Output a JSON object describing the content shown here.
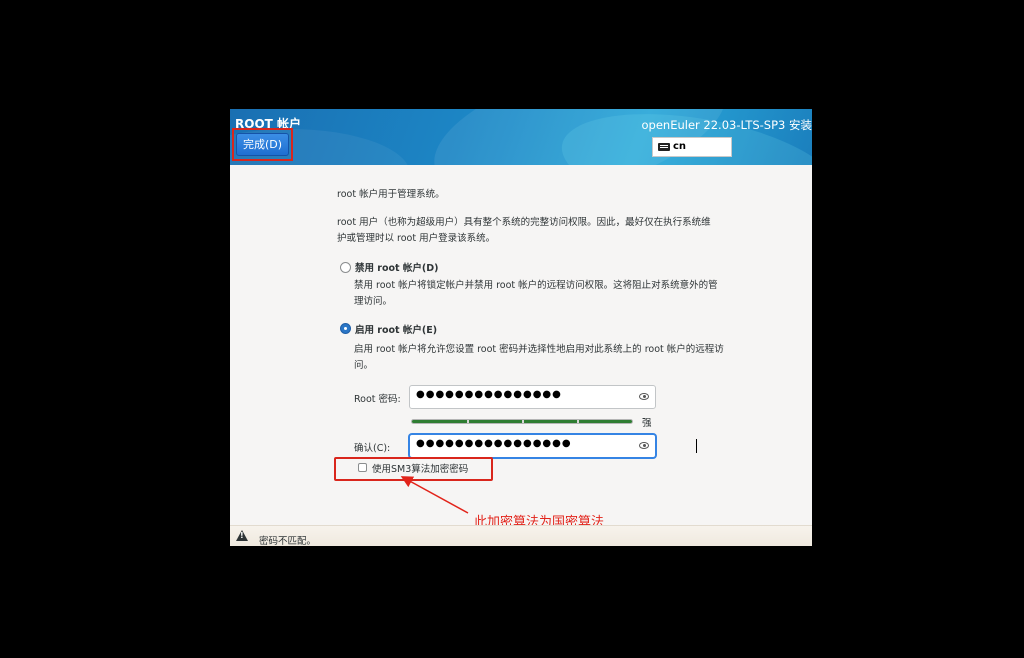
{
  "header": {
    "title": "ROOT 帐户",
    "done_label": "完成(D)",
    "product": "openEuler 22.03-LTS-SP3 安装",
    "keyboard_layout": "cn"
  },
  "body": {
    "intro": "root 帐户用于管理系统。",
    "description": "root 用户（也称为超级用户）具有整个系统的完整访问权限。因此，最好仅在执行系统维护或管理时以 root 用户登录该系统。",
    "options": [
      {
        "label": "禁用 root 帐户(D)",
        "description": "禁用 root 帐户将锁定帐户并禁用 root 帐户的远程访问权限。这将阻止对系统意外的管理访问。",
        "selected": false
      },
      {
        "label": "启用 root 帐户(E)",
        "description": "启用 root 帐户将允许您设置 root 密码并选择性地启用对此系统上的 root 帐户的远程访问。",
        "selected": true
      }
    ],
    "password_label": "Root 密码:",
    "password_masked": "●●●●●●●●●●●●●●●",
    "strength_label": "强",
    "strength_level": 1.0,
    "confirm_label": "确认(C):",
    "confirm_masked": "●●●●●●●●●●●●●●●●",
    "sm3_label": "使用SM3算法加密密码",
    "sm3_checked": false
  },
  "annotation": {
    "text": "此加密算法为国密算法",
    "color": "#e2231a"
  },
  "status": {
    "message": "密码不匹配。"
  }
}
